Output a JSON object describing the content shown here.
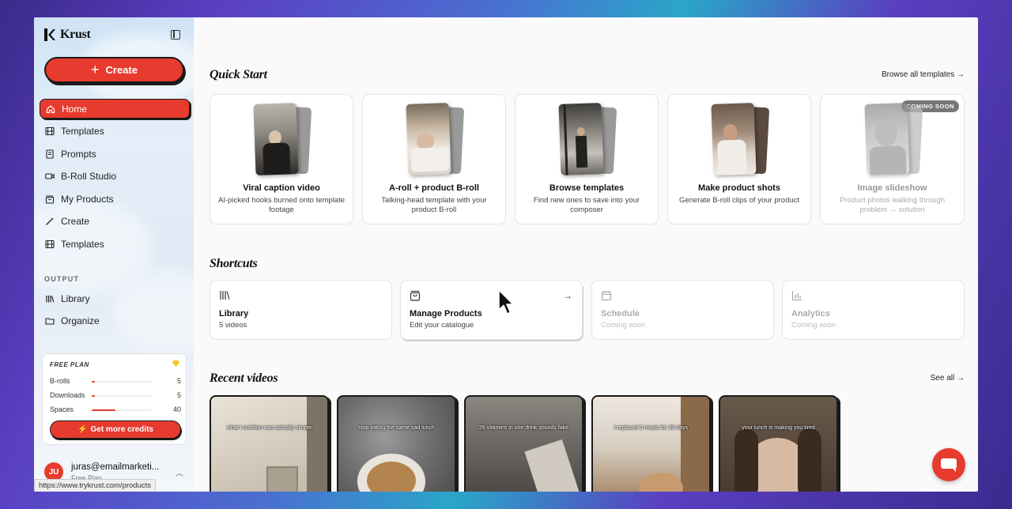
{
  "brand": {
    "name": "Krust"
  },
  "sidebar": {
    "create_label": "Create",
    "items": [
      {
        "label": "Home",
        "icon": "home-icon"
      },
      {
        "label": "Templates",
        "icon": "film-icon"
      },
      {
        "label": "Prompts",
        "icon": "document-icon"
      },
      {
        "label": "B-Roll Studio",
        "icon": "video-icon"
      },
      {
        "label": "My Products",
        "icon": "bag-icon"
      },
      {
        "label": "Create",
        "icon": "wand-icon"
      },
      {
        "label": "Templates",
        "icon": "film-icon"
      }
    ],
    "output_label": "OUTPUT",
    "output_items": [
      {
        "label": "Library",
        "icon": "library-icon"
      },
      {
        "label": "Organize",
        "icon": "folder-icon"
      }
    ],
    "plan": {
      "title": "FREE PLAN",
      "rows": [
        {
          "label": "B-rolls",
          "value": "5",
          "fill": 0.05
        },
        {
          "label": "Downloads",
          "value": "5",
          "fill": 0.05
        },
        {
          "label": "Spaces",
          "value": "40",
          "fill": 0.4
        }
      ],
      "credits_label": "Get more credits"
    },
    "user": {
      "initials": "JU",
      "email": "juras@emailmarketi...",
      "plan": "Free Plan"
    },
    "url_tooltip": "https://www.trykrust.com/products"
  },
  "main": {
    "quick_start": {
      "title": "Quick Start",
      "browse_all": "Browse all templates →",
      "cards": [
        {
          "title": "Viral caption video",
          "desc": "AI-picked hooks burned onto template footage"
        },
        {
          "title": "A-roll + product B-roll",
          "desc": "Talking-head template with your product B-roll"
        },
        {
          "title": "Browse templates",
          "desc": "Find new ones to save into your composer"
        },
        {
          "title": "Make product shots",
          "desc": "Generate B-roll clips of your product"
        },
        {
          "title": "Image slideshow",
          "desc": "Product photos walking through problem → solution",
          "badge": "COMING SOON"
        }
      ]
    },
    "shortcuts": {
      "title": "Shortcuts",
      "cards": [
        {
          "title": "Library",
          "sub": "5 videos",
          "icon": "library-icon"
        },
        {
          "title": "Manage Products",
          "sub": "Edit your catalogue",
          "icon": "bag-icon"
        },
        {
          "title": "Schedule",
          "sub": "Coming soon",
          "icon": "calendar-icon"
        },
        {
          "title": "Analytics",
          "sub": "Coming soon",
          "icon": "chart-icon"
        }
      ]
    },
    "recent": {
      "title": "Recent videos",
      "see_all": "See all →",
      "videos": [
        {
          "caption": "what i nutrition was actually simple"
        },
        {
          "caption": "stop eating the same sad lunch"
        },
        {
          "caption": "26 vitamins in one drink sounds fake"
        },
        {
          "caption": "i replaced 3 meals for 30 days"
        },
        {
          "caption": "your lunch is making you tired"
        }
      ]
    }
  },
  "colors": {
    "accent": "#e63b2e",
    "ink": "#1a1a1a"
  }
}
